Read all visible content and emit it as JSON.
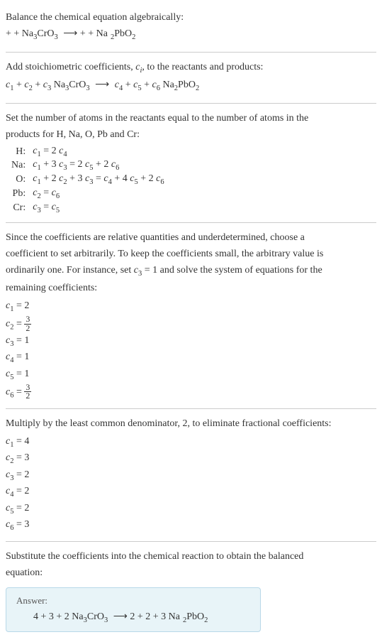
{
  "chart_data": {
    "type": "table",
    "title": "Balance chemical equation algebraically",
    "unknowns": [
      "c1",
      "c2",
      "c3",
      "c4",
      "c5",
      "c6"
    ],
    "element_balance": [
      {
        "element": "H",
        "equation": "c1 = 2 c4"
      },
      {
        "element": "Na",
        "equation": "c1 + 3 c3 = 2 c5 + 2 c6"
      },
      {
        "element": "O",
        "equation": "c1 + 2 c2 + 3 c3 = c4 + 4 c5 + 2 c6"
      },
      {
        "element": "Pb",
        "equation": "c2 = c6"
      },
      {
        "element": "Cr",
        "equation": "c3 = c5"
      }
    ],
    "set_value": {
      "var": "c3",
      "value": 1
    },
    "solution_fractional": {
      "c1": 2,
      "c2": "3/2",
      "c3": 1,
      "c4": 1,
      "c5": 1,
      "c6": "3/2"
    },
    "lcd": 2,
    "solution_integer": {
      "c1": 4,
      "c2": 3,
      "c3": 2,
      "c4": 2,
      "c5": 2,
      "c6": 3
    },
    "balanced_equation": "4 + 3 + 2 Na3CrO3 ⟶ 2 + 2 + 3 Na2PbO2"
  },
  "s1": {
    "line1": "Balance the chemical equation algebraically:",
    "line2_a": " +  + Na",
    "line2_b": "CrO",
    "line2_c": " ⟶  +  + Na",
    "line2_d": "PbO"
  },
  "s2": {
    "line1_a": "Add stoichiometric coefficients, ",
    "line1_b": "c",
    "line1_c": "i",
    "line1_d": ", to the reactants and products:",
    "line2_a": "c",
    "line2_b": "  + ",
    "line2_c": "c",
    "line2_d": "  + ",
    "line2_e": "c",
    "line2_f": " Na",
    "line2_g": "CrO",
    "line2_h": " ⟶ ",
    "line2_i": "c",
    "line2_j": "  + ",
    "line2_k": "c",
    "line2_l": "  + ",
    "line2_m": "c",
    "line2_n": " Na",
    "line2_o": "PbO"
  },
  "s3": {
    "line1": "Set the number of atoms in the reactants equal to the number of atoms in the",
    "line2": "products for H, Na, O, Pb and Cr:",
    "rows": [
      {
        "el": "H:",
        "eq_parts": [
          "c",
          "1",
          " = 2 ",
          "c",
          "4"
        ]
      },
      {
        "el": "Na:",
        "eq_parts": [
          "c",
          "1",
          " + 3 ",
          "c",
          "3",
          " = 2 ",
          "c",
          "5",
          " + 2 ",
          "c",
          "6"
        ]
      },
      {
        "el": "O:",
        "eq_parts": [
          "c",
          "1",
          " + 2 ",
          "c",
          "2",
          " + 3 ",
          "c",
          "3",
          " = ",
          "c",
          "4",
          " + 4 ",
          "c",
          "5",
          " + 2 ",
          "c",
          "6"
        ]
      },
      {
        "el": "Pb:",
        "eq_parts": [
          "c",
          "2",
          " = ",
          "c",
          "6"
        ]
      },
      {
        "el": "Cr:",
        "eq_parts": [
          "c",
          "3",
          " = ",
          "c",
          "5"
        ]
      }
    ]
  },
  "s4": {
    "line1": "Since the coefficients are relative quantities and underdetermined, choose a",
    "line2": "coefficient to set arbitrarily. To keep the coefficients small, the arbitrary value is",
    "line3_a": "ordinarily one. For instance, set ",
    "line3_b": "c",
    "line3_c": " = 1 and solve the system of equations for the",
    "line4": "remaining coefficients:",
    "coeffs": [
      {
        "var": "c",
        "sub": "1",
        "eq": " = 2",
        "frac": null
      },
      {
        "var": "c",
        "sub": "2",
        "eq": " = ",
        "frac": {
          "n": "3",
          "d": "2"
        }
      },
      {
        "var": "c",
        "sub": "3",
        "eq": " = 1",
        "frac": null
      },
      {
        "var": "c",
        "sub": "4",
        "eq": " = 1",
        "frac": null
      },
      {
        "var": "c",
        "sub": "5",
        "eq": " = 1",
        "frac": null
      },
      {
        "var": "c",
        "sub": "6",
        "eq": " = ",
        "frac": {
          "n": "3",
          "d": "2"
        }
      }
    ]
  },
  "s5": {
    "line1": "Multiply by the least common denominator, 2, to eliminate fractional coefficients:",
    "coeffs": [
      {
        "var": "c",
        "sub": "1",
        "eq": " = 4"
      },
      {
        "var": "c",
        "sub": "2",
        "eq": " = 3"
      },
      {
        "var": "c",
        "sub": "3",
        "eq": " = 2"
      },
      {
        "var": "c",
        "sub": "4",
        "eq": " = 2"
      },
      {
        "var": "c",
        "sub": "5",
        "eq": " = 2"
      },
      {
        "var": "c",
        "sub": "6",
        "eq": " = 3"
      }
    ]
  },
  "s6": {
    "line1": "Substitute the coefficients into the chemical reaction to obtain the balanced",
    "line2": "equation:",
    "answer_label": "Answer:",
    "answer_a": "4  + 3  + 2 Na",
    "answer_b": "CrO",
    "answer_c": " ⟶ 2  + 2  + 3 Na",
    "answer_d": "PbO"
  },
  "sub3": "3",
  "sub2": "2",
  "sub1": "1",
  "sub4": "4",
  "sub5": "5",
  "sub6": "6"
}
